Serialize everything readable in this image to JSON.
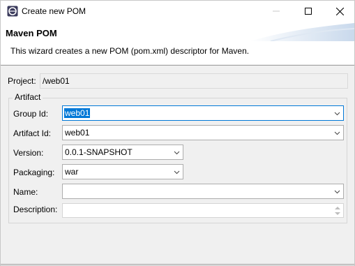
{
  "window": {
    "title": "Create new POM",
    "app_icon": "eclipse-icon",
    "controls": [
      "minimize-icon",
      "maximize-icon",
      "close-icon"
    ]
  },
  "header": {
    "title": "Maven POM",
    "description": "This wizard creates a new POM (pom.xml) descriptor for Maven."
  },
  "project": {
    "label": "Project:",
    "value": "/web01"
  },
  "artifact": {
    "group_label": "Artifact",
    "group_id": {
      "label": "Group Id:",
      "value": "web01"
    },
    "artifact_id": {
      "label": "Artifact Id:",
      "value": "web01"
    },
    "version": {
      "label": "Version:",
      "value": "0.0.1-SNAPSHOT"
    },
    "packaging": {
      "label": "Packaging:",
      "value": "war"
    },
    "name": {
      "label": "Name:",
      "value": ""
    },
    "description": {
      "label": "Description:",
      "value": ""
    }
  },
  "colors": {
    "accent": "#0078d7",
    "background": "#f0f0f0",
    "header_background": "#ffffff"
  }
}
